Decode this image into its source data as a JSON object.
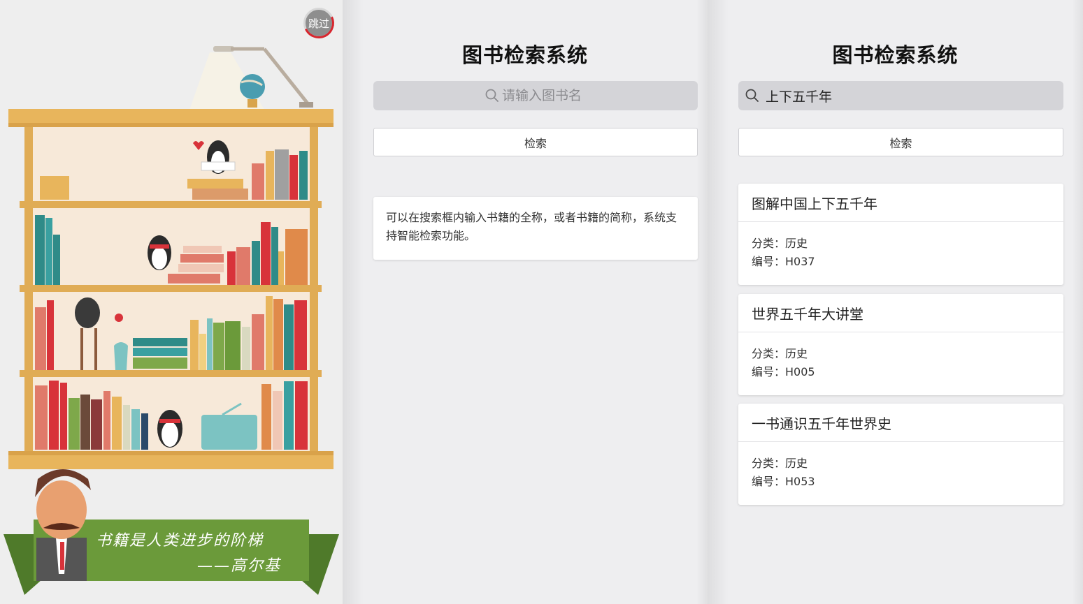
{
  "splash": {
    "skip_label": "跳过",
    "quote": "书籍是人类进步的阶梯",
    "quote_author": "——高尔基",
    "colors": {
      "shelf": "#e8b55c",
      "ribbon": "#6b9a3a"
    }
  },
  "empty_screen": {
    "title": "图书检索系统",
    "search_placeholder": "请输入图书名",
    "search_value": "",
    "search_button": "检索",
    "hint": "可以在搜索框内输入书籍的全称，或者书籍的简称，系统支持智能检索功能。"
  },
  "results_screen": {
    "title": "图书检索系统",
    "search_value": "上下五千年",
    "search_button": "检索",
    "results": [
      {
        "title": "图解中国上下五千年",
        "category": "分类：历史",
        "code": "编号：H037"
      },
      {
        "title": "世界五千年大讲堂",
        "category": "分类：历史",
        "code": "编号：H005"
      },
      {
        "title": "一书通识五千年世界史",
        "category": "分类：历史",
        "code": "编号：H053"
      }
    ]
  },
  "icons": {
    "search": "search-icon",
    "skip": "skip-countdown-icon"
  }
}
